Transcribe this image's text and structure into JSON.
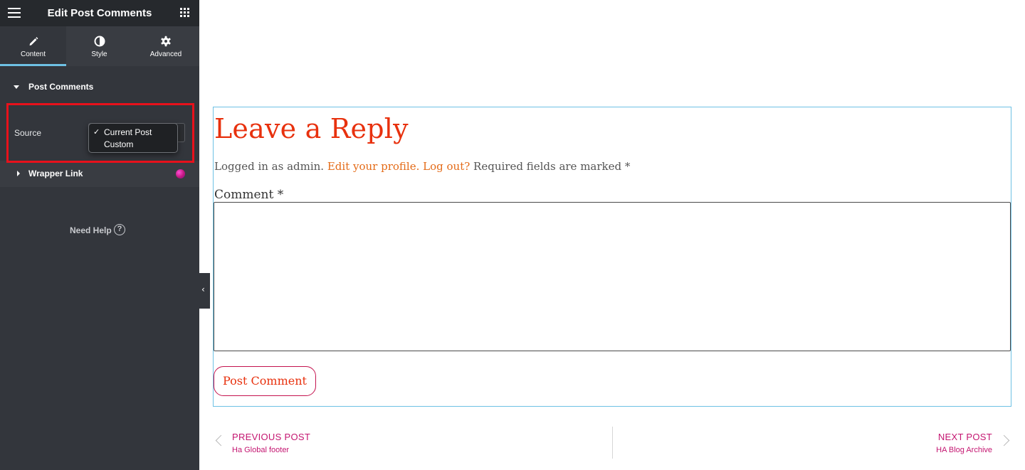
{
  "panel": {
    "title": "Edit Post Comments",
    "tabs": [
      {
        "label": "Content",
        "icon": "pencil-icon",
        "active": true
      },
      {
        "label": "Style",
        "icon": "half-circle-icon",
        "active": false
      },
      {
        "label": "Advanced",
        "icon": "gear-icon",
        "active": false
      }
    ],
    "section": {
      "title": "Post Comments",
      "expanded": true
    },
    "source": {
      "label": "Source",
      "options": [
        "Current Post",
        "Custom"
      ],
      "selected": "Current Post",
      "check_mark": "✓"
    },
    "wrapper_link": {
      "title": "Wrapper Link",
      "expanded": false
    },
    "help": {
      "label": "Need Help",
      "icon_glyph": "?"
    },
    "collapse_glyph": "‹",
    "colors": {
      "accent": "#6ec1e4",
      "highlight": "#e8111b",
      "panel_bg": "#33363c"
    }
  },
  "preview": {
    "heading": "Leave a Reply",
    "logged_in": {
      "prefix": "Logged in as admin.",
      "edit_profile": "Edit your profile.",
      "log_out": "Log out?",
      "required": "Required fields are marked *"
    },
    "comment_label": "Comment *",
    "comment_value": "",
    "submit_label": "Post Comment",
    "prev": {
      "kicker": "PREVIOUS POST",
      "title": "Ha Global footer"
    },
    "next": {
      "kicker": "NEXT POST",
      "title": "HA Blog Archive"
    },
    "colors": {
      "heading": "#e8310e",
      "link": "#e46b18",
      "nav": "#c41671",
      "button_border": "#c4134e"
    }
  }
}
